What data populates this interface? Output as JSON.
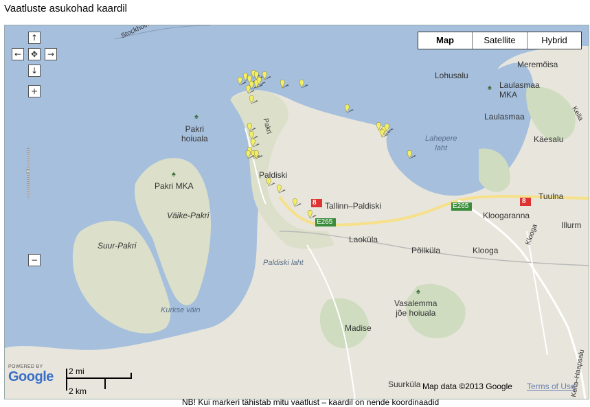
{
  "page_title": "Vaatluste asukohad kaardil",
  "map_type_buttons": [
    "Map",
    "Satellite",
    "Hybrid"
  ],
  "labels": {
    "stockholm": "Stockholm",
    "lohusalu": "Lohusalu",
    "meremoisa": "Meremõisa",
    "laulasmaa_mka": "Laulasmaa\nMKA",
    "laulasmaa": "Laulasmaa",
    "kaesalu": "Käesalu",
    "kelia": "Keila",
    "lahepere_laht": "Lahepere\nlaht",
    "pakri_hoiuala": "Pakri\nhoiuala",
    "pakri_mka": "Pakri MKA",
    "vaike_pakri": "Väike-Pakri",
    "suur_pakri": "Suur-Pakri",
    "paldiski": "Paldiski",
    "pakri_road": "Pakri",
    "tallinn_paldiski": "Tallinn–Paldiski",
    "e265_a": "E265",
    "e265_b": "E265",
    "route_8_a": "8",
    "route_8_b": "8",
    "tuulna": "Tuulna",
    "kloogaranna": "Kloogaranna",
    "illurm": "Illurm",
    "laokula": "Laoküla",
    "pollkula": "Põllküla",
    "klooga": "Klooga",
    "klooga_road": "Klooga",
    "paldiski_laht": "Paldiski laht",
    "kurkse_vain": "Kurkse väin",
    "vasalemma_hoiuala": "Vasalemma\njõe hoiuala",
    "madise": "Madise",
    "suurkula": "Suurküla",
    "keila_haapsalu": "Keila–Haapsalu"
  },
  "scale": {
    "miles": "2 mi",
    "km": "2 km"
  },
  "attribution": {
    "powered_by": "POWERED BY",
    "logo_text": "Google",
    "copyright": "Map data ©2013 Google",
    "terms": "Terms of Use"
  },
  "footer_text": "NB! Kui markeri tähistab mitu vaatlust – kaardil on nende koordinaadid"
}
